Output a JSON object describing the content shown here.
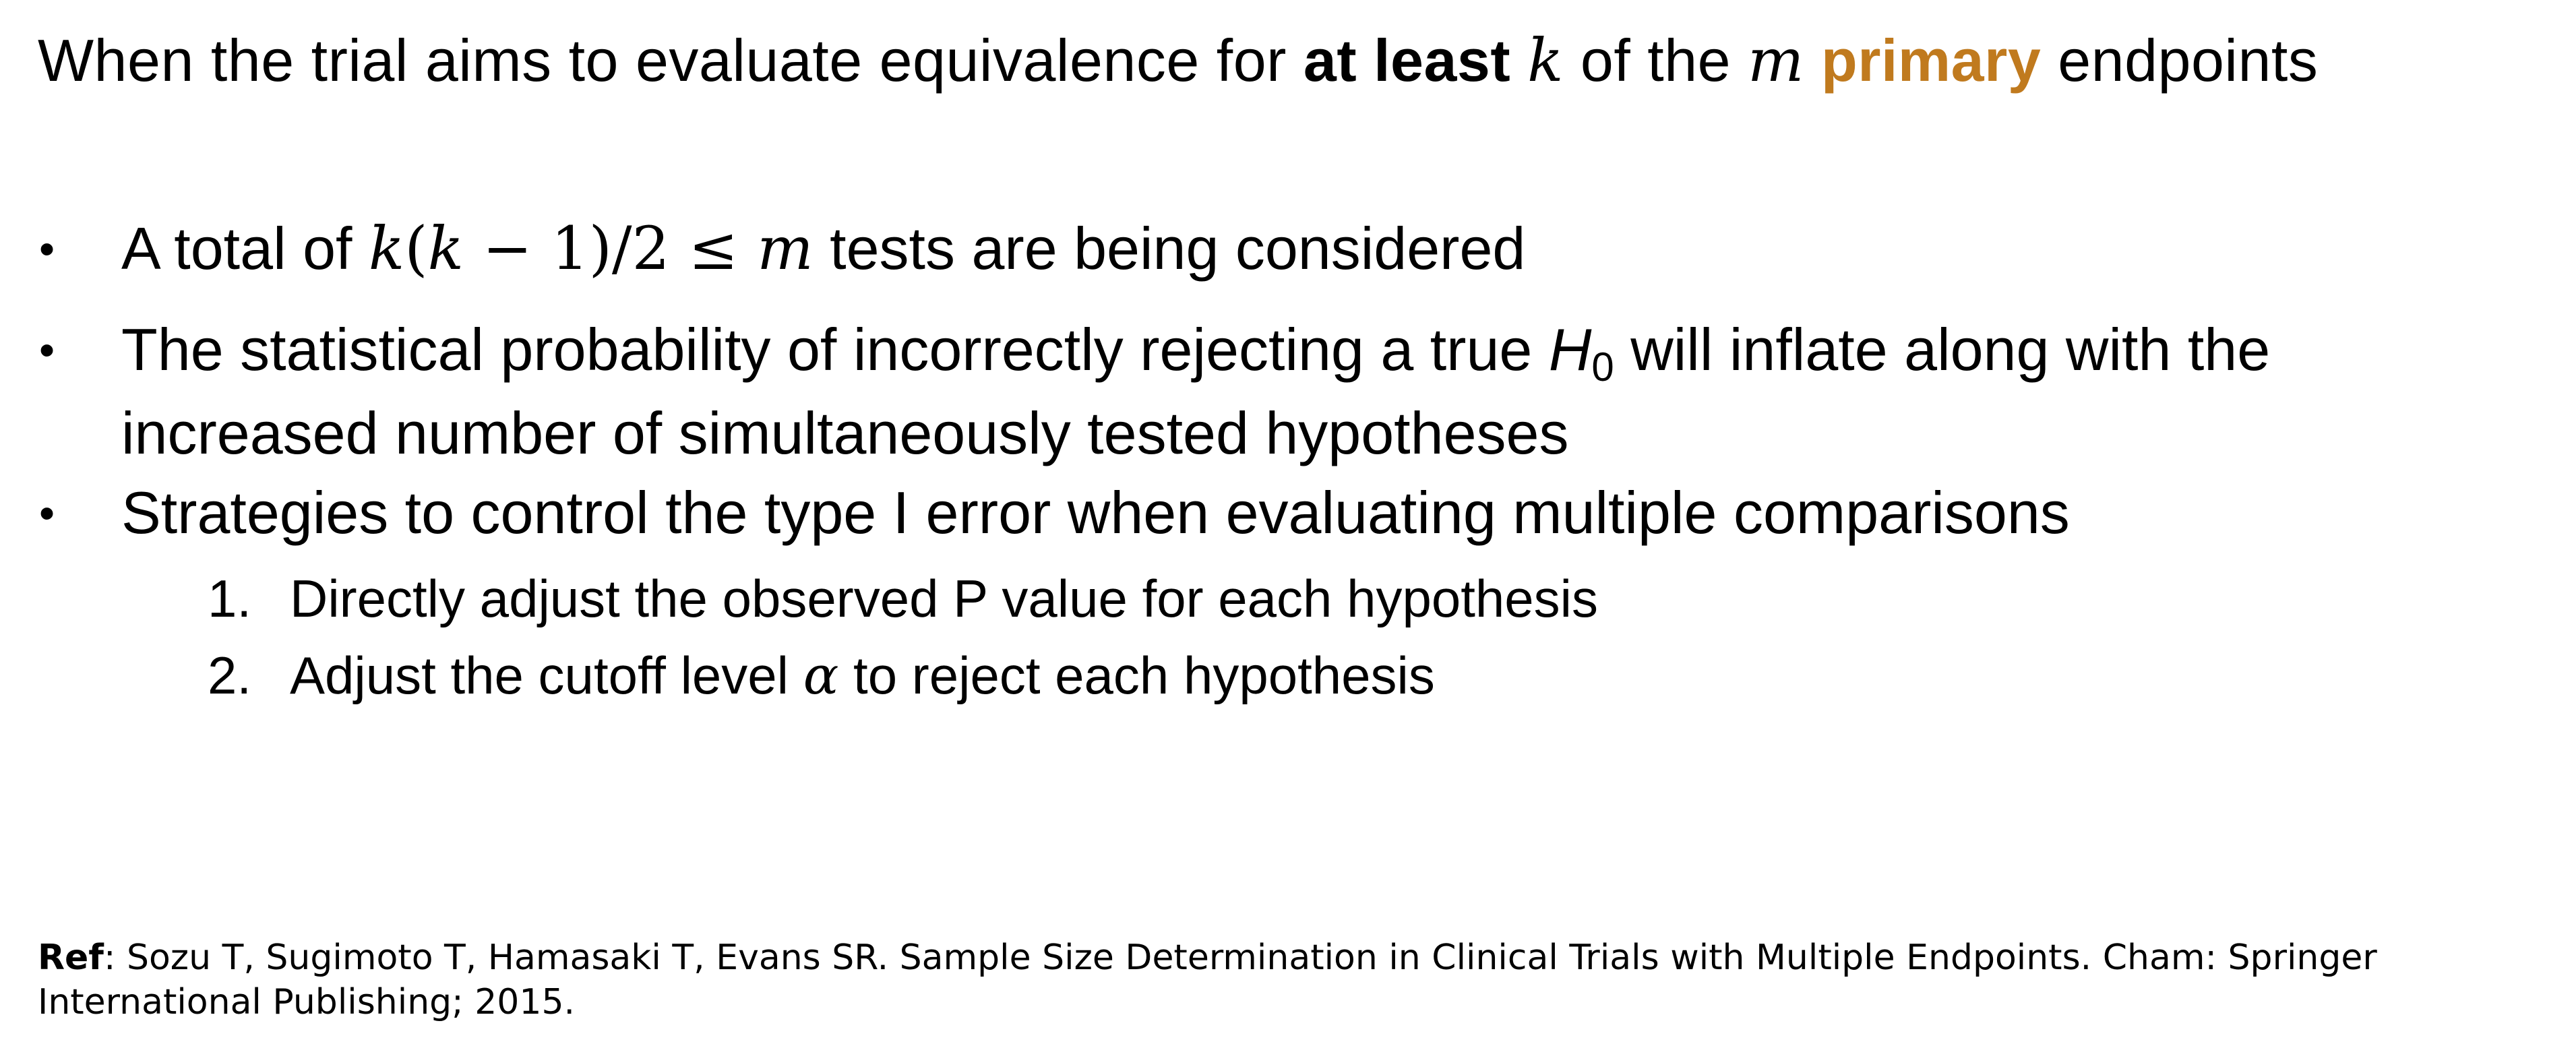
{
  "title": {
    "prefix": "When the trial aims to evaluate equivalence for ",
    "bold": "at least",
    "var_k": "k",
    "middle": " of the ",
    "var_m": "m",
    "highlight": "primary",
    "suffix": " endpoints",
    "highlight_color": "#c07a1e"
  },
  "bullets": [
    {
      "marker": "•",
      "prefix": "A total of ",
      "math": "k(k − 1)/2 ≤ m",
      "math_parts": [
        "k",
        "(",
        "k",
        " − 1)/2 ≤ ",
        "m"
      ],
      "suffix": " tests are being considered"
    },
    {
      "marker": "•",
      "line1_prefix": "The statistical probability of incorrectly rejecting a true ",
      "h_var": "H",
      "h_sub": "0",
      "line1_suffix": " will inflate along with the",
      "line2": "increased number of simultaneously tested hypotheses"
    },
    {
      "marker": "•",
      "text": "Strategies to control the type I error when evaluating multiple comparisons"
    }
  ],
  "subitems": [
    {
      "number": "1.",
      "text": "Directly adjust the observed P value for each hypothesis"
    },
    {
      "number": "2.",
      "prefix": "Adjust the cutoff level ",
      "math": "α",
      "suffix": " to reject each hypothesis"
    }
  ],
  "reference": {
    "label": "Ref",
    "text": ": Sozu T, Sugimoto T, Hamasaki T, Evans SR. Sample Size Determination in Clinical Trials with Multiple Endpoints. Cham: Springer",
    "text2": "International Publishing; 2015."
  }
}
